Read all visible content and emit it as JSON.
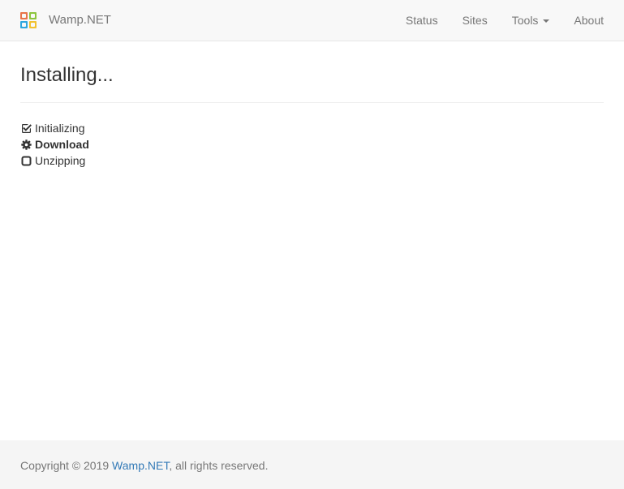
{
  "navbar": {
    "brand": "Wamp.NET",
    "items": [
      {
        "label": "Status"
      },
      {
        "label": "Sites"
      },
      {
        "label": "Tools"
      },
      {
        "label": "About"
      }
    ]
  },
  "main": {
    "title": "Installing...",
    "steps": [
      {
        "label": "Initializing",
        "state": "done",
        "icon": "check-square-icon"
      },
      {
        "label": "Download",
        "state": "active",
        "icon": "gear-icon"
      },
      {
        "label": "Unzipping",
        "state": "pending",
        "icon": "square-icon"
      }
    ]
  },
  "footer": {
    "prefix": "Copyright © 2019 ",
    "link": "Wamp.NET",
    "suffix": ", all rights reserved."
  },
  "colors": {
    "navbar_bg": "#f8f8f8",
    "link": "#337ab7",
    "muted": "#777777"
  }
}
